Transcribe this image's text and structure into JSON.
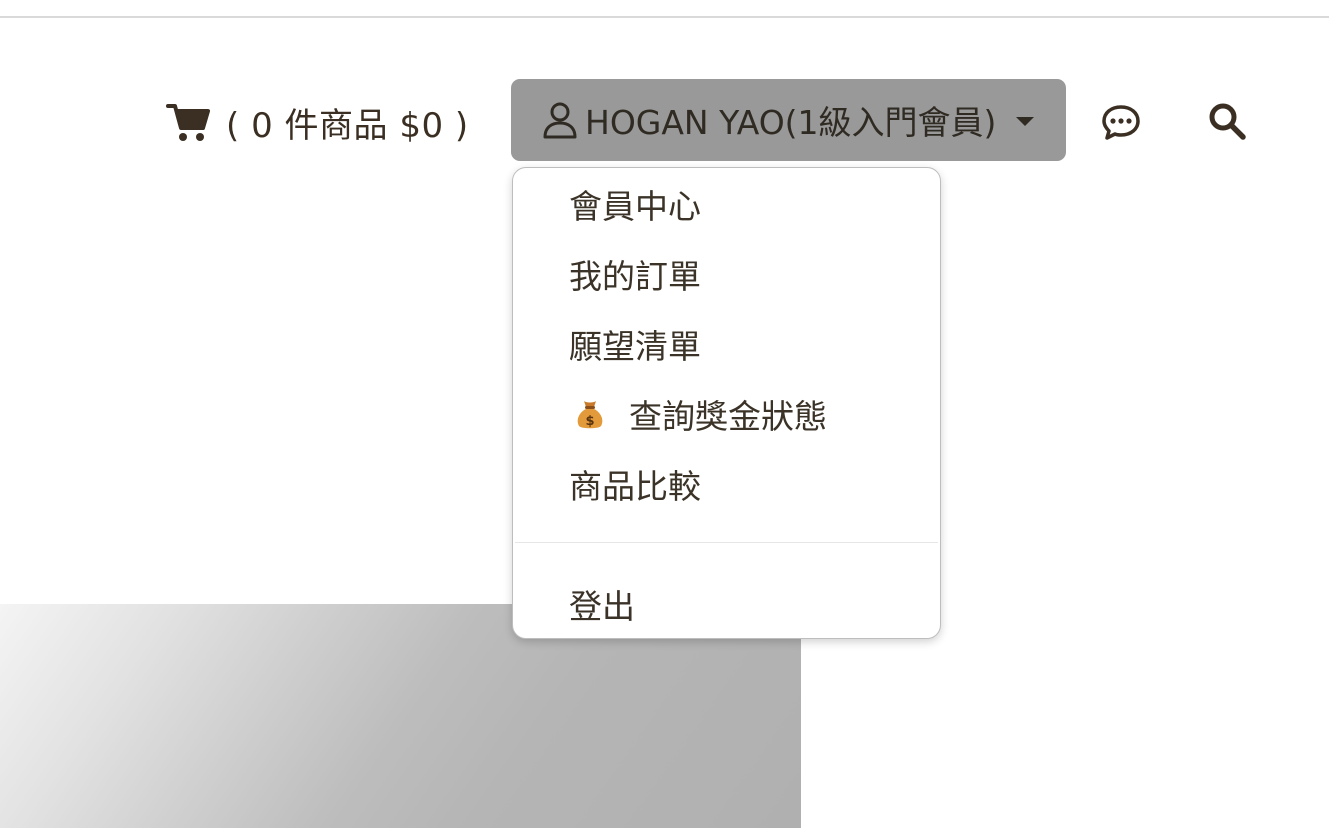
{
  "header": {
    "cart_text": "( 0 件商品 $0 )",
    "account_label": "HOGAN YAO(1級入門會員)"
  },
  "icons": {
    "cart": "cart-icon",
    "user": "user-icon",
    "caret": "caret-down-icon",
    "chat": "chat-bubble-icon",
    "search": "search-icon",
    "money_bag": "money-bag-icon"
  },
  "dropdown": {
    "items": [
      {
        "label": "會員中心"
      },
      {
        "label": "我的訂單"
      },
      {
        "label": "願望清單"
      },
      {
        "label": "查詢獎金狀態"
      },
      {
        "label": "商品比較"
      }
    ],
    "logout_label": "登出"
  },
  "colors": {
    "account_button_bg": "#999999",
    "text_dark": "#3a2f22",
    "divider": "#e6e6e6"
  }
}
